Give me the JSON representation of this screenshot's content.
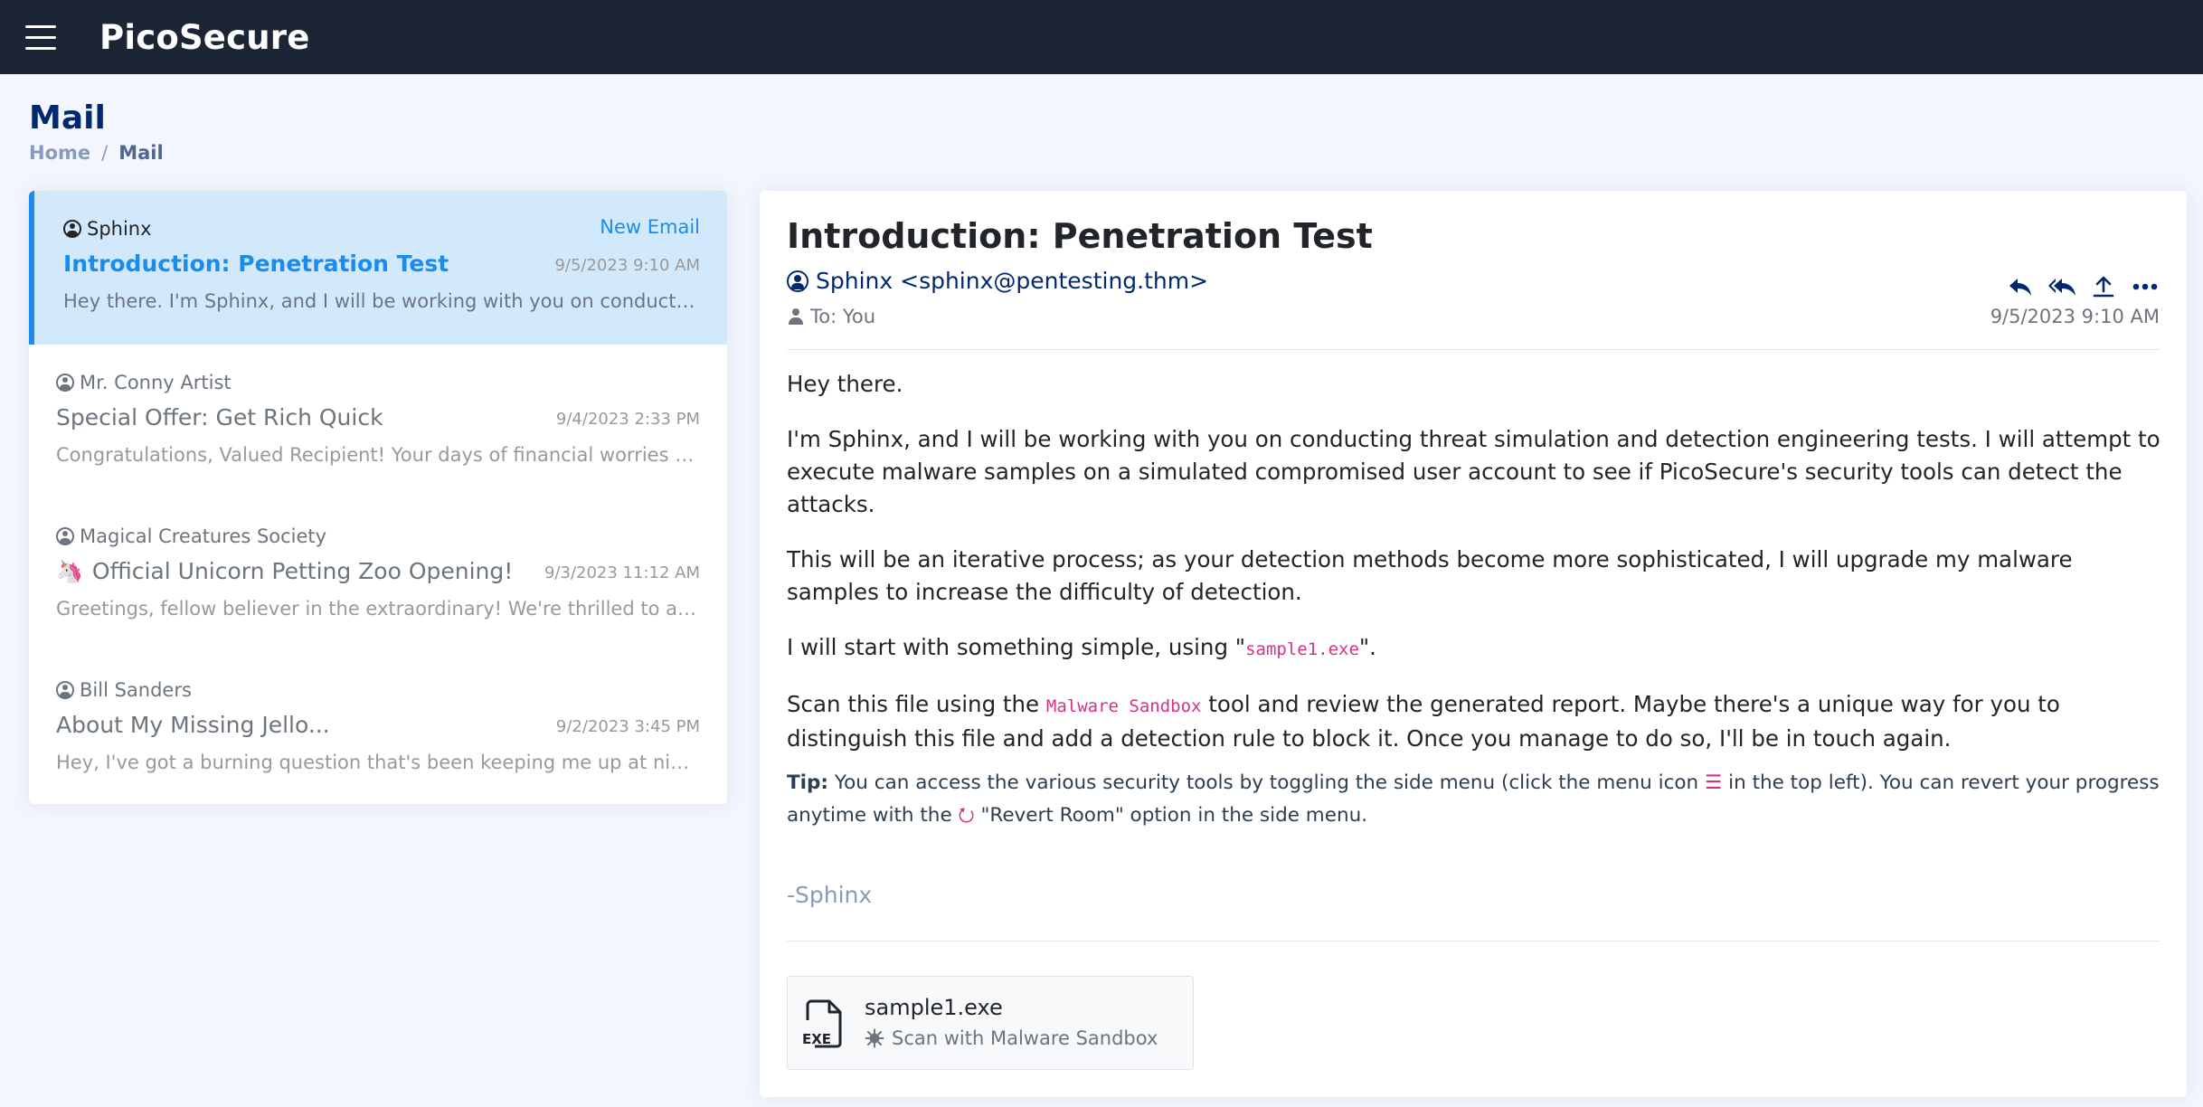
{
  "app": {
    "brand": "PicoSecure"
  },
  "page": {
    "title": "Mail",
    "breadcrumb": {
      "home": "Home",
      "sep": "/",
      "current": "Mail"
    }
  },
  "inbox": {
    "new_email_label": "New Email",
    "items": [
      {
        "sender": "Sphinx",
        "subject": "Introduction: Penetration Test",
        "date": "9/5/2023 9:10 AM",
        "preview": "Hey there. I'm Sphinx, and I will be working with you on conducting threat simulation and detection engineering tests."
      },
      {
        "sender": "Mr. Conny Artist",
        "subject": "Special Offer: Get Rich Quick",
        "date": "9/4/2023 2:33 PM",
        "preview": "Congratulations, Valued Recipient! Your days of financial worries are over!"
      },
      {
        "sender": "Magical Creatures Society",
        "subject": "Official Unicorn Petting Zoo Opening!",
        "subject_emoji": "🦄",
        "date": "9/3/2023 11:12 AM",
        "preview": "Greetings, fellow believer in the extraordinary! We're thrilled to announce"
      },
      {
        "sender": "Bill Sanders",
        "subject": "About My Missing Jello...",
        "date": "9/2/2023 3:45 PM",
        "preview": "Hey, I've got a burning question that's been keeping me up at night... where is my jello?"
      }
    ]
  },
  "reader": {
    "subject": "Introduction: Penetration Test",
    "from": "Sphinx <sphinx@pentesting.thm>",
    "to": "To: You",
    "date": "9/5/2023 9:10 AM",
    "actions": [
      "reply-icon",
      "reply-all-icon",
      "forward-icon",
      "more-icon"
    ],
    "body": {
      "p1": "Hey there.",
      "p2": "I'm Sphinx, and I will be working with you on conducting threat simulation and detection engineering tests. I will attempt to execute malware samples on a simulated compromised user account to see if PicoSecure's security tools can detect the attacks.",
      "p3": "This will be an iterative process; as your detection methods become more sophisticated, I will upgrade my malware samples to increase the difficulty of detection.",
      "p4_pre": "I will start with something simple, using \"",
      "p4_code": "sample1.exe",
      "p4_post": "\".",
      "p5_pre": "Scan this file using the ",
      "p5_code": "Malware Sandbox",
      "p5_post": " tool and review the generated report. Maybe there's a unique way for you to distinguish this file and add a detection rule to block it. Once you manage to do so, I'll be in touch again."
    },
    "tip": {
      "label": "Tip:",
      "part1": " You can access the various security tools by toggling the side menu (click the menu icon ",
      "menu_glyph": "☰",
      "part2": " in the top left). You can revert your progress anytime with the ",
      "revert_glyph": "⭮",
      "part3": " \"Revert Room\" option in the side menu."
    },
    "signature": "-Sphinx",
    "attachment": {
      "name": "sample1.exe",
      "file_label": "EXE",
      "action": "Scan with Malware Sandbox"
    }
  },
  "colors": {
    "topbar": "#1c2535",
    "accent": "#1a8cf0",
    "navy": "#012970",
    "code": "#d63384"
  }
}
